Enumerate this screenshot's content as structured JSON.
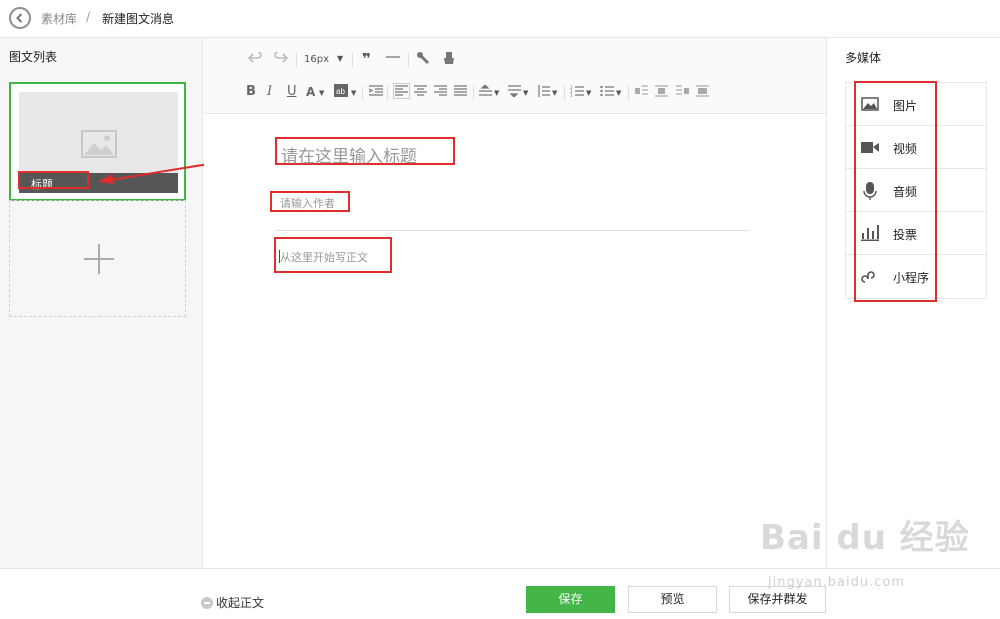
{
  "breadcrumb": {
    "root": "素材库",
    "separator": "/",
    "current": "新建图文消息"
  },
  "left_panel": {
    "title": "图文列表",
    "card_title": "标题"
  },
  "toolbar": {
    "font_size": "16px"
  },
  "editor": {
    "title_placeholder": "请在这里输入标题",
    "author_placeholder": "请输入作者",
    "body_placeholder": "从这里开始写正文"
  },
  "media": {
    "title": "多媒体",
    "items": [
      {
        "label": "图片",
        "icon": "image-icon"
      },
      {
        "label": "视频",
        "icon": "video-icon"
      },
      {
        "label": "音频",
        "icon": "microphone-icon"
      },
      {
        "label": "投票",
        "icon": "poll-icon"
      },
      {
        "label": "小程序",
        "icon": "mini-program-icon"
      }
    ]
  },
  "footer": {
    "collapse_label": "收起正文",
    "save_label": "保存",
    "preview_label": "预览",
    "publish_label": "保存并群发"
  },
  "watermark": {
    "main": "Bai du 经验",
    "sub": "jingyan.baidu.com"
  },
  "colors": {
    "accent_green": "#44b549",
    "highlight_red": "#e02d2d",
    "selected_border": "#3fb544"
  }
}
